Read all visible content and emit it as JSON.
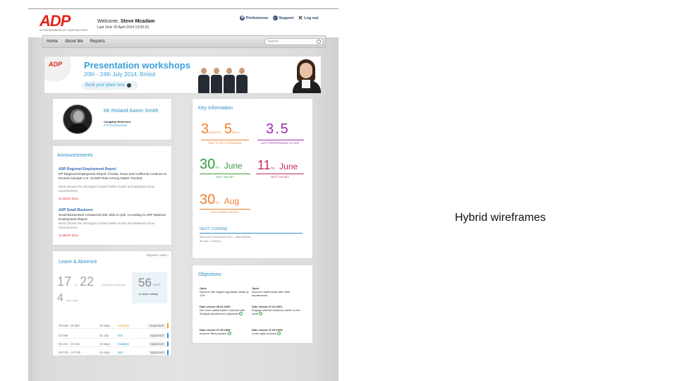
{
  "slide_caption": "Hybrid wireframes",
  "header": {
    "logo_text": "ADP",
    "logo_tagline": "IN THE BUSINESS OF YOUR SUCCESS",
    "welcome_prefix": "Welcome,",
    "welcome_name": "Steve Mcadam",
    "last_visit": "Last Visit: 02 April 2014 13:03:23",
    "links": [
      {
        "label": "Preferences",
        "icon": "gear-icon"
      },
      {
        "label": "Support",
        "icon": "chat-icon"
      },
      {
        "label": "Log out",
        "icon": "close-icon"
      }
    ]
  },
  "nav": {
    "items": [
      "Home",
      "About Me",
      "Reports"
    ],
    "search_placeholder": "Search"
  },
  "banner": {
    "logo": "ADP",
    "title": "Presentation workshops",
    "date": "20th - 24th July 2014, Bristol",
    "cta": "Book your place now"
  },
  "profile": {
    "name": "Mr Roland Aaron Smith",
    "ref_label": "Company Reference",
    "ref_value": "275757532520545"
  },
  "announcements": {
    "title": "Announcements",
    "items": [
      {
        "heading": "ADP Regional Employment Report",
        "text": "DP Regional Employment Report: Florida, Texas and California Continue to Exceed Average U.S. Growth Rate Among States Tracked,",
        "sub": "West Shows the Strongest Growth While South and Midwest Show Improvement",
        "date": "12 March 2014"
      },
      {
        "heading": "ADP Small Business",
        "text": "Small Businesses Created 82,000 Jobs in April, According to ADP National Employment Report,",
        "sub": "West Shows the Strongest Growth While South and Midwest Show Improvement",
        "date": "14 March 2014"
      }
    ]
  },
  "leave": {
    "title": "Leave & Absence",
    "request": "REQUEST LEAVE",
    "taken": "17",
    "of": "of",
    "total": "22",
    "remaining_label": "holidays remaining",
    "sick": "4",
    "sick_label": "sick days",
    "reset_days": "56",
    "reset_unit": "DAYS",
    "reset_label": "to reset holiday",
    "rows": [
      {
        "dates": "06 Mar- 10 Mar",
        "days": "10 days",
        "type": "holidays",
        "status": "requested",
        "color": "#f0a02a"
      },
      {
        "dates": "02 Mar",
        "days": "01 day",
        "type": "sick",
        "status": "approved",
        "color": "#2e8fc4"
      },
      {
        "dates": "06 Jan - 10 Jan",
        "days": "10 days",
        "type": "holidays",
        "status": "approved",
        "color": "#2e8fc4"
      },
      {
        "dates": "06 Feb - 10 Feb",
        "days": "04 days",
        "type": "sick",
        "status": "approved",
        "color": "#2e8fc4"
      }
    ]
  },
  "keyinfo": {
    "title": "Key Information",
    "appraisal_months": "3",
    "appraisal_months_unit": "MONTHS",
    "appraisal_days": "5",
    "appraisal_days_unit": "DAYS",
    "appraisal_label": "TIME TO NEXT APPRAISAL",
    "score": "3.5",
    "score_label": "LAST PERFORMANCE SCORE",
    "salary1_day": "30",
    "salary1_suffix": "TH",
    "salary1_month": "June",
    "salary1_label": "NEXT SALARY",
    "salary2_day": "11",
    "salary2_suffix": "TH",
    "salary2_month": "June",
    "salary2_label": "NEXT SALARY",
    "holiday_day": "30",
    "holiday_suffix": "TH",
    "holiday_month": "Aug",
    "holiday_label": "NEXT BANK HOLIDAY",
    "course_title": "NEXT COURSE",
    "course_name": "Microsoft Powerpoint 2011 - Intermediate",
    "course_when": "9th Apr, Chertsey",
    "colors": {
      "orange": "#f07f2a",
      "purple": "#9b2fae",
      "green": "#3a9b3f",
      "crimson": "#c42b5c",
      "blue": "#2e8fc4"
    }
  },
  "objectives": {
    "title": "Objectives",
    "items": [
      {
        "status": "Open",
        "text": "Improve 360 degree appraisal rating by 12%"
      },
      {
        "status": "Open",
        "text": "Improve relationship with other departments"
      },
      {
        "status": "Date closed 09.01.2000",
        "text": "Get more stakeholders onboard with Analysis department objectives"
      },
      {
        "status": "Date closed 27.02.2001",
        "text": "Engage with the business earlier in the cycle"
      },
      {
        "status": "Date closed 27.09.1999",
        "text": "Improve filling system"
      },
      {
        "status": "Date closed 27.05.1999",
        "text": "Learn agile process"
      }
    ]
  }
}
